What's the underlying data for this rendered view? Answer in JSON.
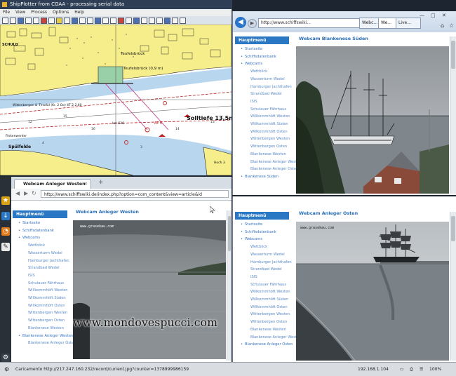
{
  "shipplotter": {
    "title": "ShipPlotter from COAA - processing serial data",
    "menu": [
      "File",
      "View",
      "Process",
      "Options",
      "Help"
    ],
    "chart_labels": {
      "teufelsbruck": "Teufelsbrück",
      "teufelsbruck_depth": "Teufelsbrück (0,9 m)",
      "solltiefe": "Solltiefe 13,5m",
      "spulfeld": "Spülfelde",
      "schul": "SCHULD",
      "wittenbergen": "Wittenbergen & Tinsdal (Kr. 2 Oo) 4T 2.2.60",
      "km": "km 630",
      "finkenwerder": "Finkenwerder",
      "ap": "AP 6",
      "hoch": "Hoch 3"
    }
  },
  "browser_top": {
    "url": "http://www.schiffswiki...",
    "tabs": [
      "Webc...",
      "We...",
      "Live..."
    ],
    "page_title": "Webcam Blankenese Süden"
  },
  "browser_left": {
    "tab": "Webcam Anleger Westen",
    "url": "http://www.schiffswiki.de/index.php?option=com_content&view=article&id",
    "page_title": "Webcam Anleger Westen",
    "cam_caption": "www.grasekau.com"
  },
  "browser_right": {
    "page_title": "Webcam Anleger Osten",
    "cam_caption": "www.grasekau.com"
  },
  "nav": {
    "heading": "Hauptmenü",
    "items_top": [
      {
        "label": "Startseite",
        "level": 1
      },
      {
        "label": "Schiffsdatenbank",
        "level": 1
      },
      {
        "label": "Webcams",
        "level": 1
      },
      {
        "label": "Wettblick",
        "level": 2
      },
      {
        "label": "Wasserturm Wedel",
        "level": 2
      },
      {
        "label": "Hamburger Jachthafen",
        "level": 2
      },
      {
        "label": "Strandbad Wedel",
        "level": 2
      },
      {
        "label": "ISIS",
        "level": 2
      },
      {
        "label": "Schulauer Fährhaus",
        "level": 2
      },
      {
        "label": "Willkommhöft Westen",
        "level": 2
      },
      {
        "label": "Willkommhöft Süden",
        "level": 2
      },
      {
        "label": "Willkommhöft Osten",
        "level": 2
      },
      {
        "label": "Wittenbergen Westen",
        "level": 2
      },
      {
        "label": "Wittenbergen Osten",
        "level": 2
      },
      {
        "label": "Blankenese Westen",
        "level": 2
      },
      {
        "label": "Blankenese Anleger Westen",
        "level": 2
      },
      {
        "label": "Blankenese Anleger Osten",
        "level": 2
      },
      {
        "label": "Blankenese Süden",
        "level": 1
      }
    ],
    "items_left": [
      {
        "label": "Startseite",
        "level": 1
      },
      {
        "label": "Schiffsdatenbank",
        "level": 1
      },
      {
        "label": "Webcams",
        "level": 1
      },
      {
        "label": "Wettblick",
        "level": 2
      },
      {
        "label": "Wasserturm Wedel",
        "level": 2
      },
      {
        "label": "Hamburger Jachthafen",
        "level": 2
      },
      {
        "label": "Strandbad Wedel",
        "level": 2
      },
      {
        "label": "ISIS",
        "level": 2
      },
      {
        "label": "Schulauer Fährhaus",
        "level": 2
      },
      {
        "label": "Willkommhöft Westen",
        "level": 2
      },
      {
        "label": "Willkommhöft Süden",
        "level": 2
      },
      {
        "label": "Willkommhöft Osten",
        "level": 2
      },
      {
        "label": "Wittenbergen Westen",
        "level": 2
      },
      {
        "label": "Wittenbergen Osten",
        "level": 2
      },
      {
        "label": "Blankenese Westen",
        "level": 2
      },
      {
        "label": "Blankenese Anleger Westen",
        "level": 1
      },
      {
        "label": "Blankenese Anleger Osten",
        "level": 2
      }
    ],
    "items_right": [
      {
        "label": "Startseite",
        "level": 1
      },
      {
        "label": "Schiffsdatenbank",
        "level": 1
      },
      {
        "label": "Webcams",
        "level": 1
      },
      {
        "label": "Wettblick",
        "level": 2
      },
      {
        "label": "Wasserturm Wedel",
        "level": 2
      },
      {
        "label": "Hamburger Jachthafen",
        "level": 2
      },
      {
        "label": "Strandbad Wedel",
        "level": 2
      },
      {
        "label": "ISIS",
        "level": 2
      },
      {
        "label": "Schulauer Fährhaus",
        "level": 2
      },
      {
        "label": "Willkommhöft Westen",
        "level": 2
      },
      {
        "label": "Willkommhöft Süden",
        "level": 2
      },
      {
        "label": "Willkommhöft Osten",
        "level": 2
      },
      {
        "label": "Wittenbergen Westen",
        "level": 2
      },
      {
        "label": "Wittenbergen Osten",
        "level": 2
      },
      {
        "label": "Blankenese Westen",
        "level": 2
      },
      {
        "label": "Blankenese Anleger Westen",
        "level": 2
      },
      {
        "label": "Blankenese Anleger Osten",
        "level": 1
      }
    ]
  },
  "statusbar": {
    "text": "Caricamento http://217.247.160.232/record/current.jpg?counter=1378999986159",
    "ip": "192.168.1.104",
    "zoom": "100%"
  },
  "watermark": "www.mondovespucci.com",
  "colors": {
    "accent": "#2a77c4",
    "link": "#3a75c0",
    "chart_land": "#f6ee8a",
    "chart_water": "#ffffff"
  }
}
